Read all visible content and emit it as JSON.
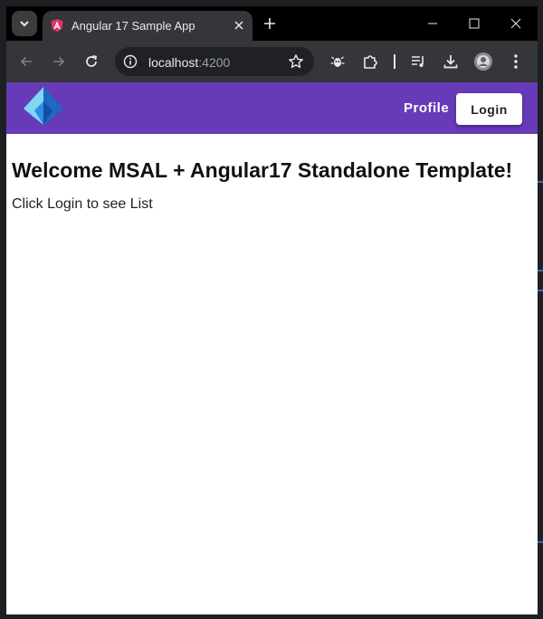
{
  "browser": {
    "tab": {
      "title": "Angular 17 Sample App"
    },
    "address_bar": {
      "host": "localhost",
      "port": ":4200"
    }
  },
  "app": {
    "header": {
      "profile_label": "Profile",
      "login_label": "Login"
    },
    "main": {
      "title": "Welcome MSAL + Angular17 Standalone Template!",
      "message": "Click Login to see List"
    }
  },
  "colors": {
    "header_bg": "#673ab7",
    "tabstrip_bg": "#000000",
    "toolbar_bg": "#35363a"
  },
  "icons": [
    "tab-search-icon",
    "angular-favicon-icon",
    "close-icon",
    "new-tab-icon",
    "minimize-icon",
    "maximize-icon",
    "window-close-icon",
    "back-arrow-icon",
    "forward-arrow-icon",
    "reload-icon",
    "info-icon",
    "star-icon",
    "extension-bug-icon",
    "puzzle-icon",
    "media-queue-icon",
    "download-icon",
    "profile-avatar-icon",
    "kebab-menu-icon",
    "azure-ad-logo-icon"
  ]
}
